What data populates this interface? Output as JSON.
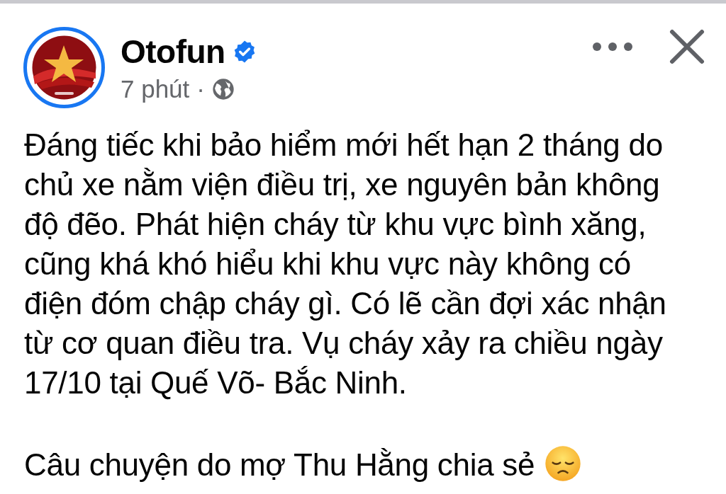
{
  "post": {
    "author": "Otofun",
    "verified": true,
    "time": "7 phút",
    "separator": "·",
    "paragraphs": [
      {
        "lines": [
          "Đáng tiếc khi bảo hiểm mới hết hạn 2 tháng do",
          "chủ xe nằm viện điều trị, xe nguyên bản không",
          "độ đẽo. Phát hiện cháy từ khu vực bình xăng,",
          "cũng khá khó hiểu khi khu vực  này không có",
          "điện đóm chập cháy gì. Có lẽ cần đợi xác nhận",
          "từ cơ quan điều tra. Vụ cháy xảy ra chiều ngày",
          "17/10 tại Quế Võ- Bắc Ninh."
        ]
      },
      {
        "lines": [
          "Câu chuyện do mợ Thu Hằng chia sẻ"
        ],
        "pensive_emoji": true
      }
    ]
  }
}
